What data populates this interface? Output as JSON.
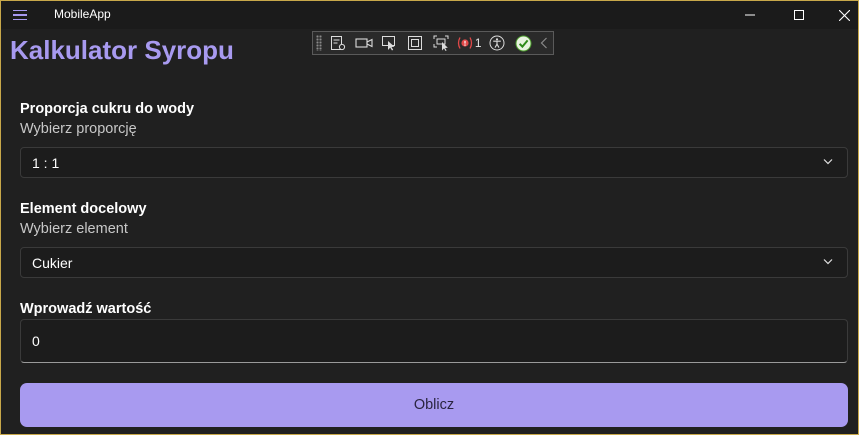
{
  "window": {
    "title": "MobileApp",
    "controls": {
      "minimize_icon": "minimize-icon",
      "maximize_icon": "maximize-icon",
      "close_icon": "close-icon"
    }
  },
  "debug_toolbar": {
    "items": [
      "live-visual-tree-icon",
      "video-camera-icon",
      "select-element-icon",
      "display-layout-adorners-icon",
      "track-focus-icon",
      "binding-failures-icon",
      "accessibility-icon",
      "checkmark-icon",
      "collapse-chevron-icon"
    ],
    "binding_failures_count": "1"
  },
  "page": {
    "title": "Kalkulator Syropu"
  },
  "ratio": {
    "label": "Proporcja cukru do wody",
    "sublabel": "Wybierz proporcję",
    "value": "1 : 1"
  },
  "target": {
    "label": "Element docelowy",
    "sublabel": "Wybierz element",
    "value": "Cukier"
  },
  "input": {
    "label": "Wprowadź wartość",
    "value": "0"
  },
  "calculate_button": {
    "label": "Oblicz"
  },
  "colors": {
    "accent": "#a89af0",
    "background": "#202020",
    "titlebar": "#1b1b1b",
    "window_border": "#c8a84a"
  }
}
